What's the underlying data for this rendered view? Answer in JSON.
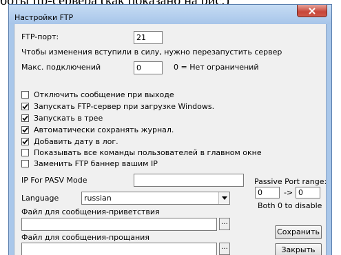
{
  "top_cutoff_text": "боты ftp-сервера (как показано на рис.)",
  "window": {
    "title": "Настройки FTP"
  },
  "port": {
    "label": "FTP-порт:",
    "value": "21"
  },
  "restart_note": "Чтобы изменения вступили в силу, нужно перезапустить сервер",
  "max_connections": {
    "label": "Макс. подключений",
    "value": "0",
    "hint": "0 = Нет ограничений"
  },
  "options": [
    {
      "label": "Отключить сообщение при выходе",
      "checked": false
    },
    {
      "label": "Запускать FTP-сервер при загрузке Windows.",
      "checked": true
    },
    {
      "label": "Запускать в трее",
      "checked": true
    },
    {
      "label": "Автоматически сохранять журнал.",
      "checked": true
    },
    {
      "label": "Добавить дату в лог.",
      "checked": true
    },
    {
      "label": "Показывать все команды пользователей в главном окне",
      "checked": false
    },
    {
      "label": "Заменить FTP баннер вашим IP",
      "checked": false
    }
  ],
  "pasv": {
    "label": "IP For PASV Mode",
    "value": ""
  },
  "passive_range": {
    "label": "Passive Port range:",
    "from": "0",
    "arrow": "->",
    "to": "0",
    "hint": "Both 0 to disable"
  },
  "language": {
    "label": "Language",
    "value": "russian"
  },
  "welcome_file": {
    "label": "Файл для сообщения-приветствия",
    "value": "",
    "browse": "..."
  },
  "goodbye_file": {
    "label": "Файл для сообщения-прощания",
    "value": "",
    "browse": "..."
  },
  "buttons": {
    "save": "Сохранить",
    "close": "Закрыть"
  },
  "colors": {
    "frame": "#a9c7ea",
    "client": "#f0f0f0",
    "close_button": "#c7463a"
  },
  "icons": {
    "close": "close-icon",
    "dropdown": "chevron-down-icon",
    "check": "check-icon"
  }
}
